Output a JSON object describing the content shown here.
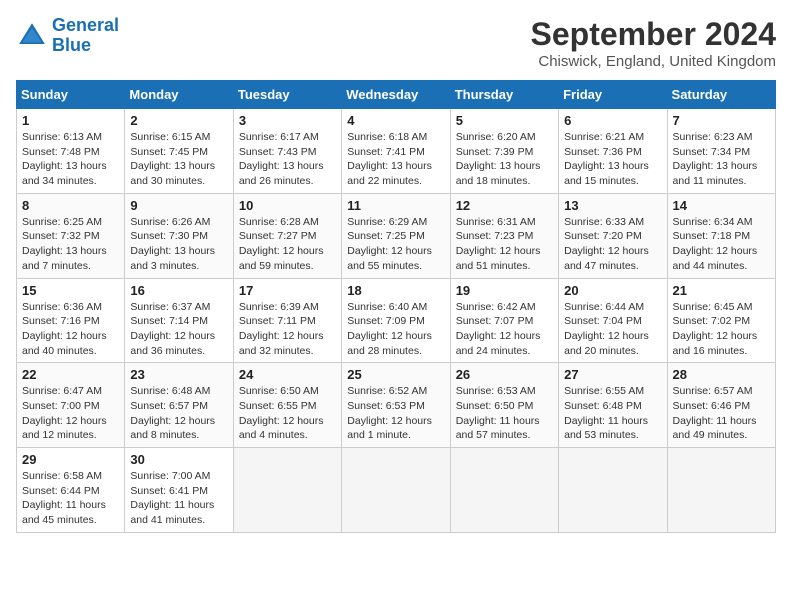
{
  "logo": {
    "line1": "General",
    "line2": "Blue"
  },
  "title": "September 2024",
  "location": "Chiswick, England, United Kingdom",
  "days_of_week": [
    "Sunday",
    "Monday",
    "Tuesday",
    "Wednesday",
    "Thursday",
    "Friday",
    "Saturday"
  ],
  "weeks": [
    [
      {
        "day": "1",
        "info": "Sunrise: 6:13 AM\nSunset: 7:48 PM\nDaylight: 13 hours\nand 34 minutes."
      },
      {
        "day": "2",
        "info": "Sunrise: 6:15 AM\nSunset: 7:45 PM\nDaylight: 13 hours\nand 30 minutes."
      },
      {
        "day": "3",
        "info": "Sunrise: 6:17 AM\nSunset: 7:43 PM\nDaylight: 13 hours\nand 26 minutes."
      },
      {
        "day": "4",
        "info": "Sunrise: 6:18 AM\nSunset: 7:41 PM\nDaylight: 13 hours\nand 22 minutes."
      },
      {
        "day": "5",
        "info": "Sunrise: 6:20 AM\nSunset: 7:39 PM\nDaylight: 13 hours\nand 18 minutes."
      },
      {
        "day": "6",
        "info": "Sunrise: 6:21 AM\nSunset: 7:36 PM\nDaylight: 13 hours\nand 15 minutes."
      },
      {
        "day": "7",
        "info": "Sunrise: 6:23 AM\nSunset: 7:34 PM\nDaylight: 13 hours\nand 11 minutes."
      }
    ],
    [
      {
        "day": "8",
        "info": "Sunrise: 6:25 AM\nSunset: 7:32 PM\nDaylight: 13 hours\nand 7 minutes."
      },
      {
        "day": "9",
        "info": "Sunrise: 6:26 AM\nSunset: 7:30 PM\nDaylight: 13 hours\nand 3 minutes."
      },
      {
        "day": "10",
        "info": "Sunrise: 6:28 AM\nSunset: 7:27 PM\nDaylight: 12 hours\nand 59 minutes."
      },
      {
        "day": "11",
        "info": "Sunrise: 6:29 AM\nSunset: 7:25 PM\nDaylight: 12 hours\nand 55 minutes."
      },
      {
        "day": "12",
        "info": "Sunrise: 6:31 AM\nSunset: 7:23 PM\nDaylight: 12 hours\nand 51 minutes."
      },
      {
        "day": "13",
        "info": "Sunrise: 6:33 AM\nSunset: 7:20 PM\nDaylight: 12 hours\nand 47 minutes."
      },
      {
        "day": "14",
        "info": "Sunrise: 6:34 AM\nSunset: 7:18 PM\nDaylight: 12 hours\nand 44 minutes."
      }
    ],
    [
      {
        "day": "15",
        "info": "Sunrise: 6:36 AM\nSunset: 7:16 PM\nDaylight: 12 hours\nand 40 minutes."
      },
      {
        "day": "16",
        "info": "Sunrise: 6:37 AM\nSunset: 7:14 PM\nDaylight: 12 hours\nand 36 minutes."
      },
      {
        "day": "17",
        "info": "Sunrise: 6:39 AM\nSunset: 7:11 PM\nDaylight: 12 hours\nand 32 minutes."
      },
      {
        "day": "18",
        "info": "Sunrise: 6:40 AM\nSunset: 7:09 PM\nDaylight: 12 hours\nand 28 minutes."
      },
      {
        "day": "19",
        "info": "Sunrise: 6:42 AM\nSunset: 7:07 PM\nDaylight: 12 hours\nand 24 minutes."
      },
      {
        "day": "20",
        "info": "Sunrise: 6:44 AM\nSunset: 7:04 PM\nDaylight: 12 hours\nand 20 minutes."
      },
      {
        "day": "21",
        "info": "Sunrise: 6:45 AM\nSunset: 7:02 PM\nDaylight: 12 hours\nand 16 minutes."
      }
    ],
    [
      {
        "day": "22",
        "info": "Sunrise: 6:47 AM\nSunset: 7:00 PM\nDaylight: 12 hours\nand 12 minutes."
      },
      {
        "day": "23",
        "info": "Sunrise: 6:48 AM\nSunset: 6:57 PM\nDaylight: 12 hours\nand 8 minutes."
      },
      {
        "day": "24",
        "info": "Sunrise: 6:50 AM\nSunset: 6:55 PM\nDaylight: 12 hours\nand 4 minutes."
      },
      {
        "day": "25",
        "info": "Sunrise: 6:52 AM\nSunset: 6:53 PM\nDaylight: 12 hours\nand 1 minute."
      },
      {
        "day": "26",
        "info": "Sunrise: 6:53 AM\nSunset: 6:50 PM\nDaylight: 11 hours\nand 57 minutes."
      },
      {
        "day": "27",
        "info": "Sunrise: 6:55 AM\nSunset: 6:48 PM\nDaylight: 11 hours\nand 53 minutes."
      },
      {
        "day": "28",
        "info": "Sunrise: 6:57 AM\nSunset: 6:46 PM\nDaylight: 11 hours\nand 49 minutes."
      }
    ],
    [
      {
        "day": "29",
        "info": "Sunrise: 6:58 AM\nSunset: 6:44 PM\nDaylight: 11 hours\nand 45 minutes."
      },
      {
        "day": "30",
        "info": "Sunrise: 7:00 AM\nSunset: 6:41 PM\nDaylight: 11 hours\nand 41 minutes."
      },
      {
        "day": "",
        "info": ""
      },
      {
        "day": "",
        "info": ""
      },
      {
        "day": "",
        "info": ""
      },
      {
        "day": "",
        "info": ""
      },
      {
        "day": "",
        "info": ""
      }
    ]
  ]
}
